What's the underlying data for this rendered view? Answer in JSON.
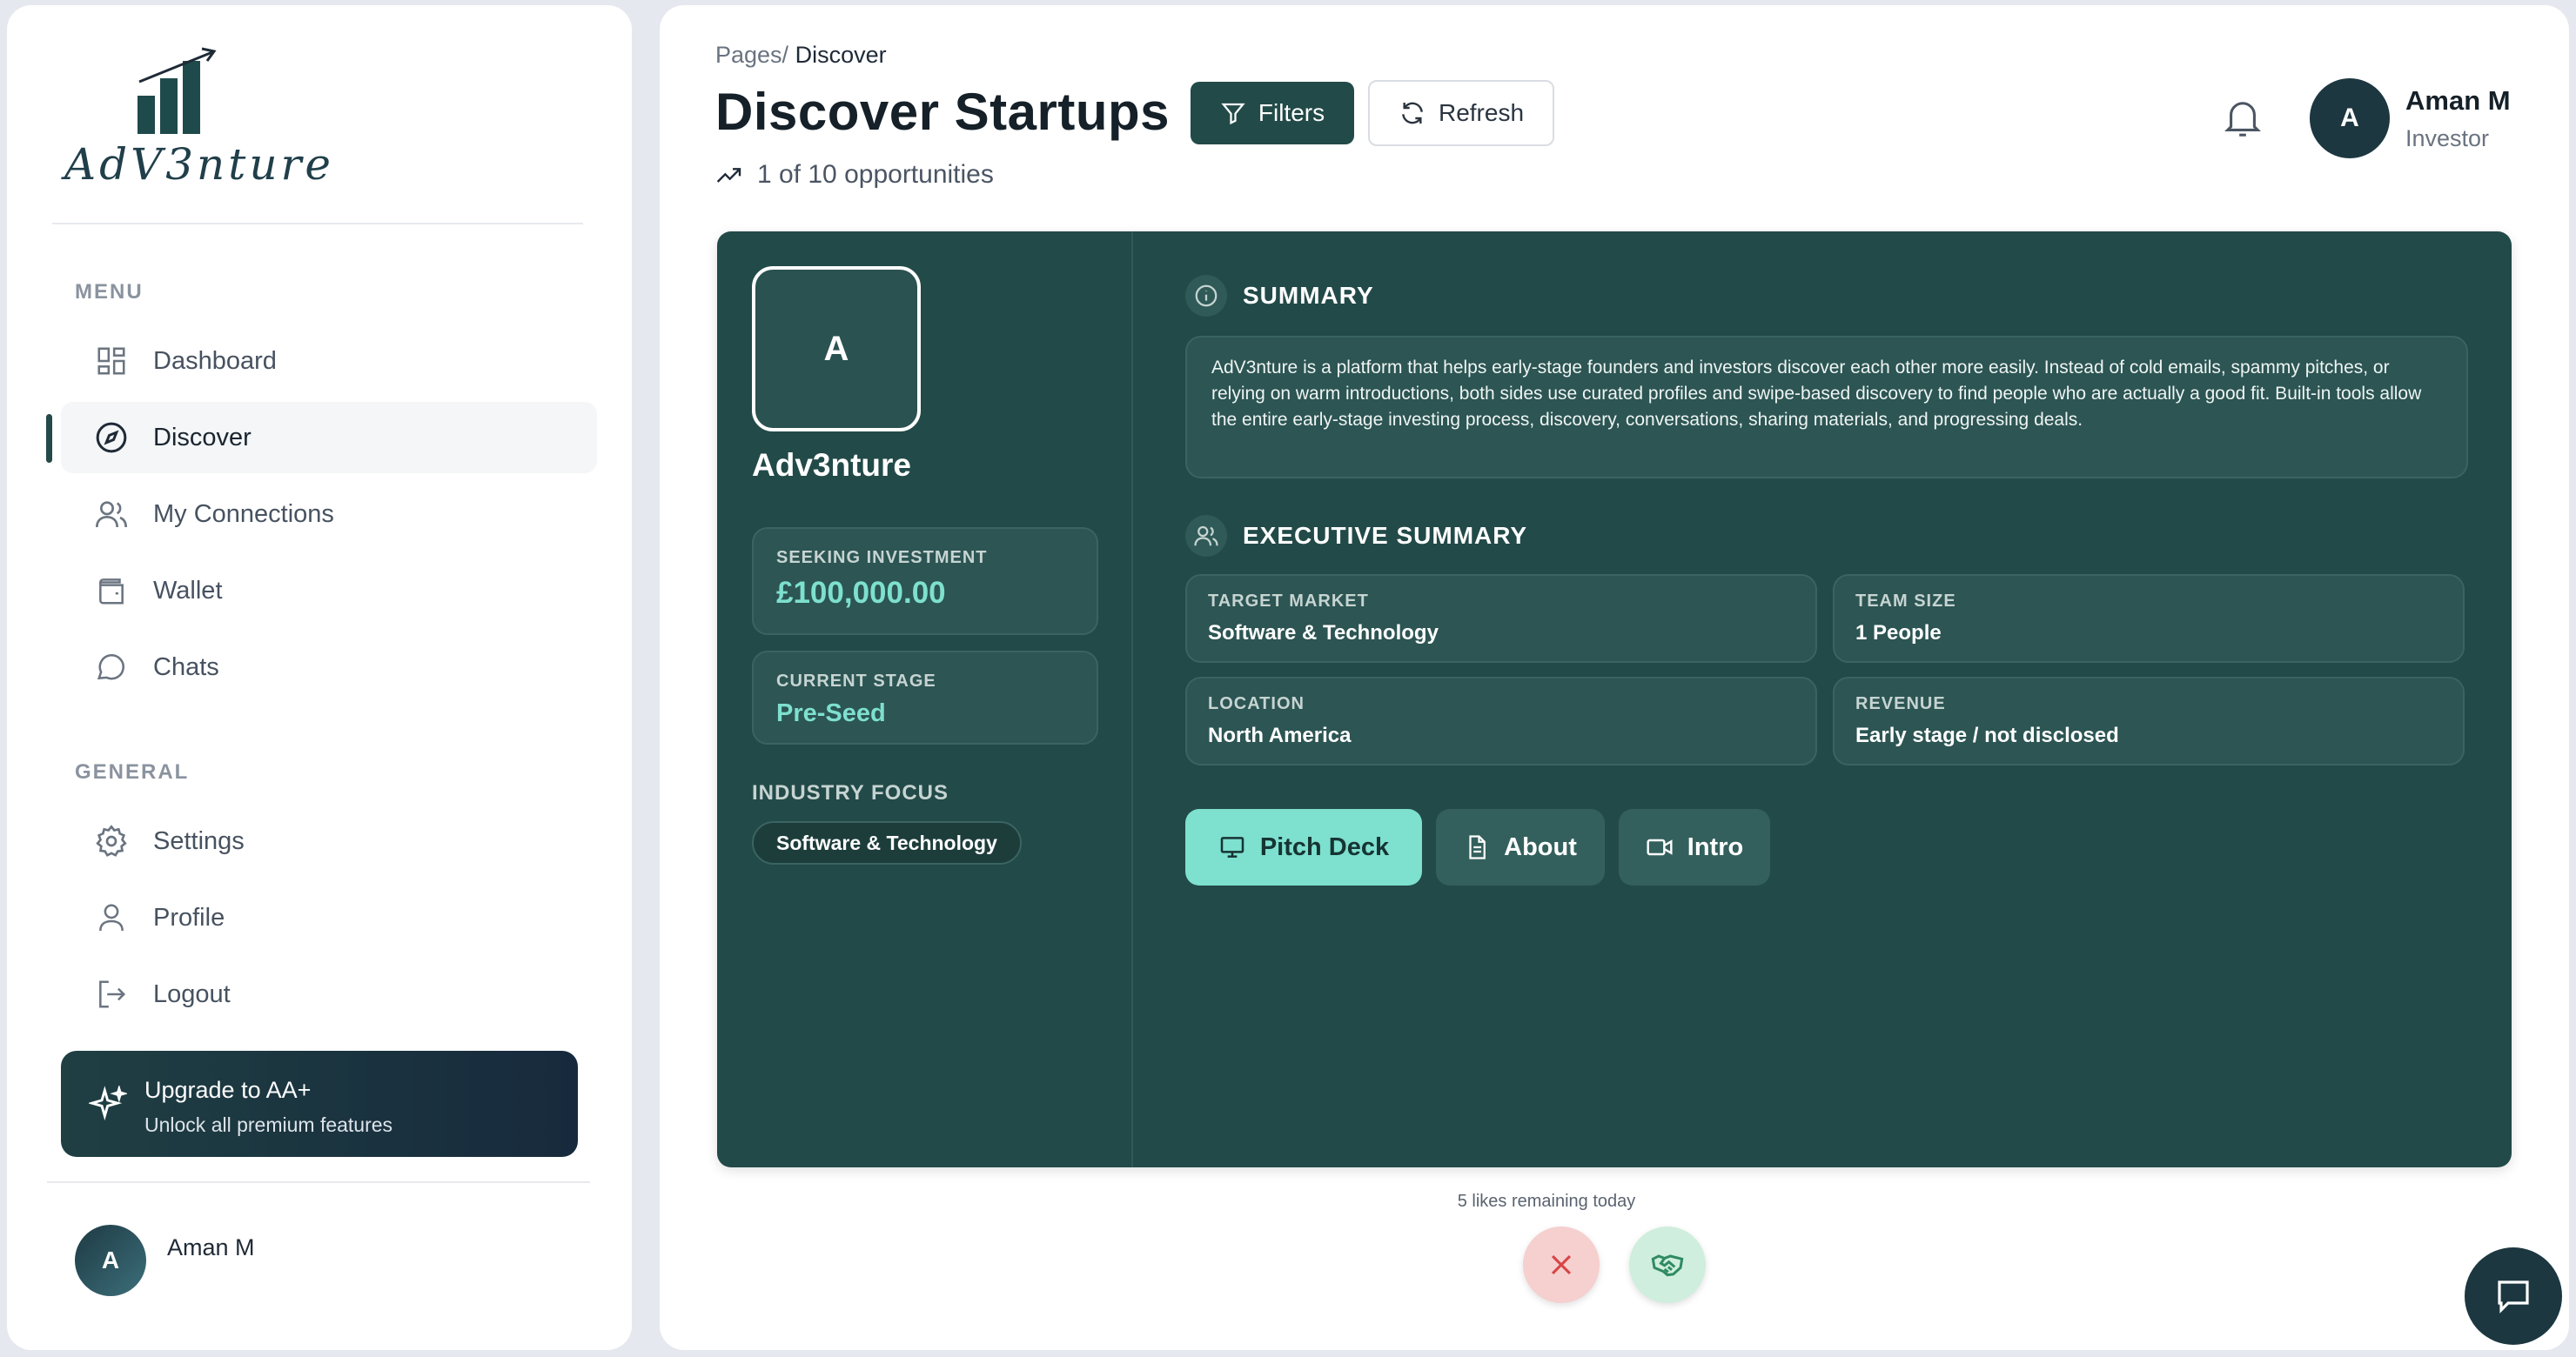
{
  "brand": {
    "name": "AdV3nture"
  },
  "sidebar": {
    "menu_label": "MENU",
    "general_label": "GENERAL",
    "menu_items": [
      {
        "label": "Dashboard",
        "icon": "grid-icon"
      },
      {
        "label": "Discover",
        "icon": "compass-icon",
        "active": true
      },
      {
        "label": "My Connections",
        "icon": "users-icon"
      },
      {
        "label": "Wallet",
        "icon": "wallet-icon"
      },
      {
        "label": "Chats",
        "icon": "chat-bubble-icon"
      }
    ],
    "general_items": [
      {
        "label": "Settings",
        "icon": "gear-icon"
      },
      {
        "label": "Profile",
        "icon": "user-icon"
      },
      {
        "label": "Logout",
        "icon": "logout-icon"
      }
    ],
    "upgrade": {
      "title": "Upgrade to AA+",
      "subtitle": "Unlock all premium features"
    },
    "user": {
      "initial": "A",
      "name": "Aman M"
    }
  },
  "header": {
    "breadcrumb_prefix": "Pages/",
    "breadcrumb_current": "Discover",
    "title": "Discover Startups",
    "filters_label": "Filters",
    "refresh_label": "Refresh",
    "opportunities": "1 of 10 opportunities",
    "user": {
      "initial": "A",
      "name": "Aman M",
      "role": "Investor"
    }
  },
  "startup": {
    "initial": "A",
    "name": "Adv3nture",
    "seeking_label": "SEEKING INVESTMENT",
    "seeking_value": "£100,000.00",
    "stage_label": "CURRENT STAGE",
    "stage_value": "Pre-Seed",
    "industry_label": "INDUSTRY FOCUS",
    "industry_tag": "Software & Technology",
    "summary_heading": "SUMMARY",
    "summary_text": "AdV3nture is a platform that helps early-stage founders and investors discover each other more easily. Instead of cold emails, spammy pitches, or relying on warm introductions, both sides use curated profiles and swipe-based discovery to find people who are actually a good fit. Built-in tools allow the entire early-stage investing process, discovery, conversations, sharing materials, and progressing deals.",
    "exec_heading": "EXECUTIVE SUMMARY",
    "exec": {
      "target_market_label": "TARGET MARKET",
      "target_market_value": "Software & Technology",
      "team_size_label": "TEAM SIZE",
      "team_size_value": "1 People",
      "location_label": "LOCATION",
      "location_value": "North America",
      "revenue_label": "REVENUE",
      "revenue_value": "Early stage / not disclosed"
    },
    "actions": {
      "pitch": "Pitch Deck",
      "about": "About",
      "intro": "Intro"
    }
  },
  "footer": {
    "likes_remaining": "5 likes remaining today"
  },
  "colors": {
    "accent": "#224a48",
    "mint": "#7ee0cf",
    "navy": "#1c3740"
  }
}
